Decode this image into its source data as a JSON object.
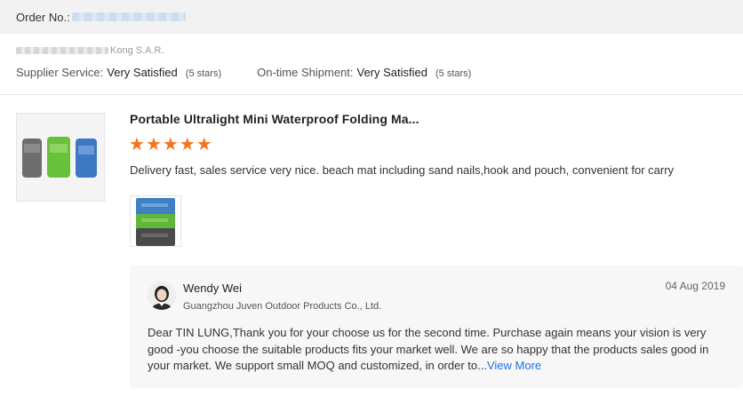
{
  "order": {
    "label": "Order No.:"
  },
  "seller_info": {
    "location_suffix": "Kong S.A.R.",
    "supplier_service_label": "Supplier Service:",
    "supplier_service_value": "Very Satisfied",
    "supplier_service_stars": "(5 stars)",
    "shipment_label": "On-time Shipment:",
    "shipment_value": "Very Satisfied",
    "shipment_stars": "(5 stars)"
  },
  "product": {
    "title": "Portable Ultralight Mini Waterproof Folding Ma...",
    "rating": 5,
    "review_text": "Delivery fast, sales service very nice. beach mat including sand nails,hook and pouch, convenient for carry"
  },
  "reply": {
    "name": "Wendy Wei",
    "company": "Guangzhou Juven Outdoor Products Co., Ltd.",
    "date": "04 Aug 2019",
    "text": "Dear TIN LUNG,Thank you for your choose us for the second time. Purchase again means  your vision is very good -you choose the suitable products fits your market well. We are so happy that  the products sales good in your market. We support small MOQ and  customized,  in order to...",
    "view_more_label": "View More"
  },
  "colors": {
    "star": "#f5731c",
    "link": "#1a73e8",
    "reply_bg": "#f7f7f7"
  }
}
